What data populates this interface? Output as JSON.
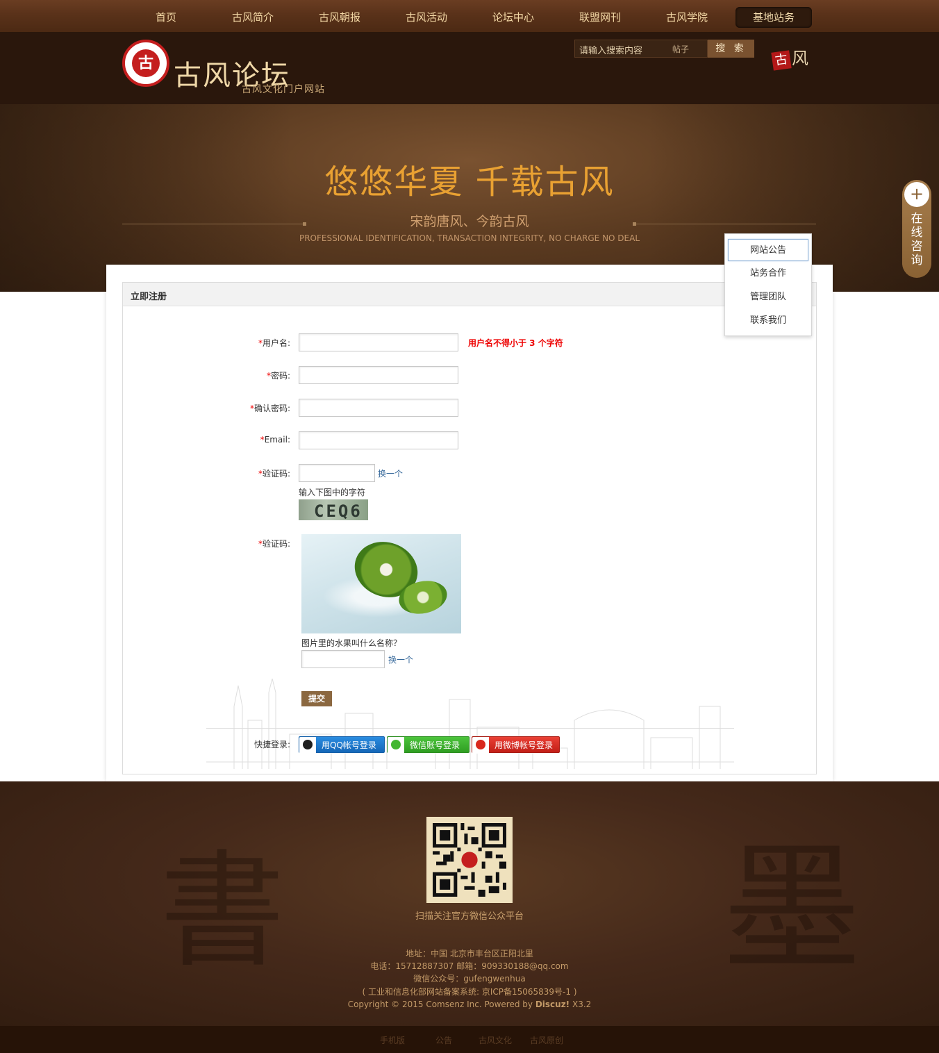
{
  "nav": {
    "items": [
      "首页",
      "古风简介",
      "古风朝报",
      "古风活动",
      "论坛中心",
      "联盟网刊",
      "古风学院",
      "基地站务"
    ],
    "active_index": 7
  },
  "header": {
    "logo_seal": "古",
    "logo_text": "古风论坛",
    "logo_sub": "古风文化门户网站",
    "search_placeholder": "请输入搜索内容",
    "search_type": "帖子",
    "search_button": "搜 索",
    "brand_mark_seal": "古",
    "brand_mark_text": "风"
  },
  "banner": {
    "title": "悠悠华夏 千载古风",
    "subtitle": "宋韵唐风、今韵古风",
    "english": "PROFESSIONAL IDENTIFICATION, TRANSACTION INTEGRITY, NO CHARGE NO DEAL"
  },
  "panel": {
    "title": "立即注册"
  },
  "form": {
    "username_label": "用户名:",
    "username_error": "用户名不得小于 3 个字符",
    "password_label": "密码:",
    "confirm_label": "确认密码:",
    "email_label": "Email:",
    "captcha_label": "验证码:",
    "captcha_refresh": "换一个",
    "captcha_hint": "输入下图中的字符",
    "captcha_text": "CEQ6",
    "qa_label": "验证码:",
    "qa_question": "图片里的水果叫什么名称？",
    "qa_refresh": "换一个",
    "submit": "提交",
    "required_mark": "*"
  },
  "quick_login": {
    "label": "快捷登录:",
    "qq": "用QQ帐号登录",
    "wechat": "微信账号登录",
    "weibo": "用微博帐号登录"
  },
  "dropdown": {
    "items": [
      "网站公告",
      "站务合作",
      "管理团队",
      "联系我们"
    ],
    "active_index": 0
  },
  "consult": {
    "plus": "+",
    "text": "在线咨询"
  },
  "footer": {
    "qr_caption": "扫描关注官方微信公众平台",
    "address": "地址：中国 北京市丰台区正阳北里",
    "contact": "电话：15712887307    邮箱：909330188@qq.com",
    "wechat": "微信公众号：gufengwenhua",
    "icp": "( 工业和信息化部网站备案系统: 京ICP备15065839号-1 )",
    "copyright_pre": "Copyright © 2015 Comsenz Inc. Powered by ",
    "copyright_brand": "Discuz!",
    "copyright_ver": " X3.2",
    "links": [
      "手机版",
      "公告",
      "古风文化",
      "古风原创"
    ]
  },
  "colors": {
    "accent_brown": "#8b6840",
    "error_red": "#e00000",
    "banner_title": "#e9a132",
    "link_blue": "#336699"
  }
}
